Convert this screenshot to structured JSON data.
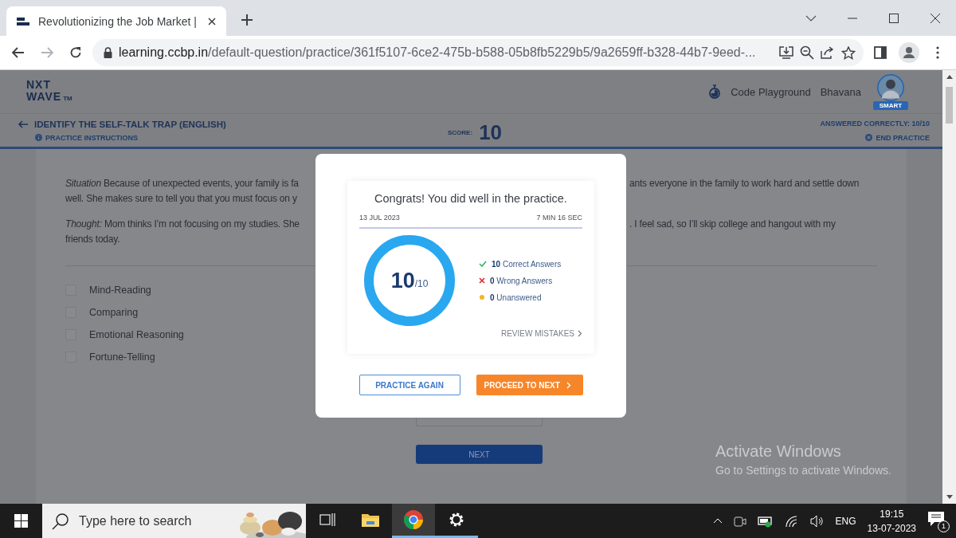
{
  "browser": {
    "tab_title": "Revolutionizing the Job Market |",
    "url_host": "learning.ccbp.in",
    "url_path": "/default-question/practice/361f5107-6ce2-475b-b588-05b8fb5229b5/9a2659ff-b328-44b7-9eed-..."
  },
  "header": {
    "logo": {
      "top": "NXT",
      "bottom": "WAVE",
      "mark": "TM"
    },
    "link": "Code Playground",
    "user": "Bhavana",
    "badge": "SMART"
  },
  "practice": {
    "title": "IDENTIFY THE SELF-TALK TRAP (ENGLISH)",
    "instructions": "PRACTICE INSTRUCTIONS",
    "score_label": "SCORE:",
    "score": "10",
    "answered": "ANSWERED CORRECTLY: 10/10",
    "end": "END PRACTICE"
  },
  "question": {
    "lines": [
      {
        "left": "*Situation* Because of unexpected events, your family is fa",
        "right": "ants everyone in the family to work hard and settle down"
      },
      {
        "left": "well. She makes sure to tell you that you must focus on y"
      },
      {
        "left": "*Thought:* Mom thinks I’m not focusing on my studies. She",
        "right": ". I feel sad, so I’ll skip college and hangout with my"
      },
      {
        "left": "friends today."
      }
    ],
    "options": [
      {
        "label": "Mind-Reading",
        "checked": false
      },
      {
        "label": "Comparing",
        "checked": false
      },
      {
        "label": "Emotional Reasoning",
        "checked": false
      },
      {
        "label": "Fortune-Telling",
        "checked": false
      }
    ],
    "next": "NEXT"
  },
  "modal": {
    "title": "Congrats! You did well in the practice.",
    "date": "13 JUL 2023",
    "duration": "7 MIN 16 SEC",
    "score": "10",
    "total": "/10",
    "level": 1,
    "stats": [
      {
        "kind": "correct",
        "count": "10",
        "label": "Correct Answers"
      },
      {
        "kind": "wrong",
        "count": "0",
        "label": "Wrong Answers"
      },
      {
        "kind": "unanswered",
        "count": "0",
        "label": "Unanswered"
      }
    ],
    "review": "REVIEW MISTAKES",
    "buttons": [
      {
        "kind": "outline",
        "label": "PRACTICE AGAIN"
      },
      {
        "kind": "primary",
        "label": "PROCEED TO NEXT"
      }
    ]
  },
  "watermark": {
    "title": "Activate Windows",
    "text": "Go to Settings to activate Windows."
  },
  "taskbar": {
    "search_placeholder": "Type here to search",
    "apps": [
      {
        "kind": "taskview",
        "selected": false,
        "running": false
      },
      {
        "kind": "explorer",
        "selected": false,
        "running": false
      },
      {
        "kind": "chrome",
        "selected": true,
        "running": true
      },
      {
        "kind": "settings",
        "selected": false,
        "running": true
      }
    ],
    "language": "ENG",
    "time": "19:15",
    "date": "13-07-2023",
    "notifications": "1"
  }
}
